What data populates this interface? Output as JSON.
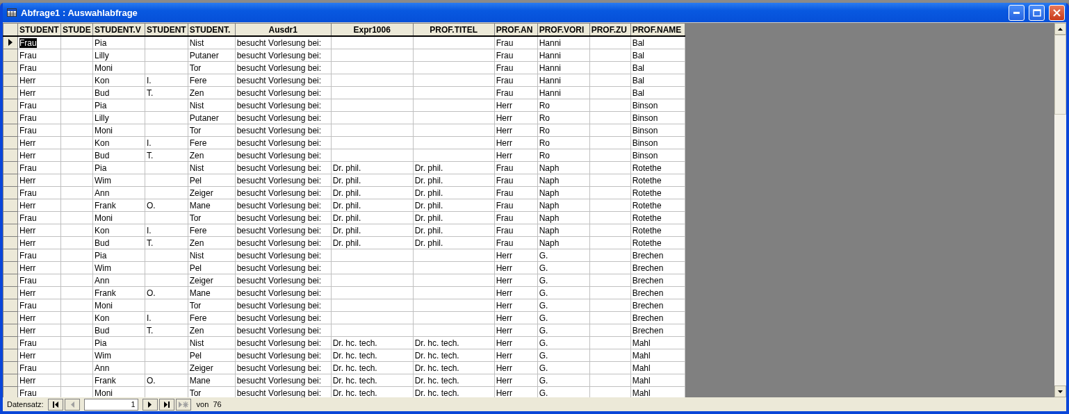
{
  "window": {
    "title": "Abfrage1 : Auswahlabfrage"
  },
  "table": {
    "columns": [
      "STUDENT",
      "STUDE",
      "STUDENT.V",
      "STUDENT",
      "STUDENT.",
      "Ausdr1",
      "Expr1006",
      "PROF.TITEL",
      "PROF.AN",
      "PROF.VORI",
      "PROF.ZU",
      "PROF.NAME"
    ],
    "rows": [
      {
        "selected": true,
        "cells": [
          "Frau",
          "",
          "Pia",
          "",
          "Nist",
          "besucht Vorlesung bei:",
          "",
          "",
          "Frau",
          "Hanni",
          "",
          "Bal"
        ]
      },
      {
        "selected": false,
        "cells": [
          "Frau",
          "",
          "Lilly",
          "",
          "Putaner",
          "besucht Vorlesung bei:",
          "",
          "",
          "Frau",
          "Hanni",
          "",
          "Bal"
        ]
      },
      {
        "selected": false,
        "cells": [
          "Frau",
          "",
          "Moni",
          "",
          "Tor",
          "besucht Vorlesung bei:",
          "",
          "",
          "Frau",
          "Hanni",
          "",
          "Bal"
        ]
      },
      {
        "selected": false,
        "cells": [
          "Herr",
          "",
          "Kon",
          "I.",
          "Fere",
          "besucht Vorlesung bei:",
          "",
          "",
          "Frau",
          "Hanni",
          "",
          "Bal"
        ]
      },
      {
        "selected": false,
        "cells": [
          "Herr",
          "",
          "Bud",
          "T.",
          "Zen",
          "besucht Vorlesung bei:",
          "",
          "",
          "Frau",
          "Hanni",
          "",
          "Bal"
        ]
      },
      {
        "selected": false,
        "cells": [
          "Frau",
          "",
          "Pia",
          "",
          "Nist",
          "besucht Vorlesung bei:",
          "",
          "",
          "Herr",
          "Ro",
          "",
          "Binson"
        ]
      },
      {
        "selected": false,
        "cells": [
          "Frau",
          "",
          "Lilly",
          "",
          "Putaner",
          "besucht Vorlesung bei:",
          "",
          "",
          "Herr",
          "Ro",
          "",
          "Binson"
        ]
      },
      {
        "selected": false,
        "cells": [
          "Frau",
          "",
          "Moni",
          "",
          "Tor",
          "besucht Vorlesung bei:",
          "",
          "",
          "Herr",
          "Ro",
          "",
          "Binson"
        ]
      },
      {
        "selected": false,
        "cells": [
          "Herr",
          "",
          "Kon",
          "I.",
          "Fere",
          "besucht Vorlesung bei:",
          "",
          "",
          "Herr",
          "Ro",
          "",
          "Binson"
        ]
      },
      {
        "selected": false,
        "cells": [
          "Herr",
          "",
          "Bud",
          "T.",
          "Zen",
          "besucht Vorlesung bei:",
          "",
          "",
          "Herr",
          "Ro",
          "",
          "Binson"
        ]
      },
      {
        "selected": false,
        "cells": [
          "Frau",
          "",
          "Pia",
          "",
          "Nist",
          "besucht Vorlesung bei:",
          "Dr. phil.",
          "Dr. phil.",
          "Frau",
          "Naph",
          "",
          "Rotethe"
        ]
      },
      {
        "selected": false,
        "cells": [
          "Herr",
          "",
          "Wim",
          "",
          "Pel",
          "besucht Vorlesung bei:",
          "Dr. phil.",
          "Dr. phil.",
          "Frau",
          "Naph",
          "",
          "Rotethe"
        ]
      },
      {
        "selected": false,
        "cells": [
          "Frau",
          "",
          "Ann",
          "",
          "Zeiger",
          "besucht Vorlesung bei:",
          "Dr. phil.",
          "Dr. phil.",
          "Frau",
          "Naph",
          "",
          "Rotethe"
        ]
      },
      {
        "selected": false,
        "cells": [
          "Herr",
          "",
          "Frank",
          "O.",
          "Mane",
          "besucht Vorlesung bei:",
          "Dr. phil.",
          "Dr. phil.",
          "Frau",
          "Naph",
          "",
          "Rotethe"
        ]
      },
      {
        "selected": false,
        "cells": [
          "Frau",
          "",
          "Moni",
          "",
          "Tor",
          "besucht Vorlesung bei:",
          "Dr. phil.",
          "Dr. phil.",
          "Frau",
          "Naph",
          "",
          "Rotethe"
        ]
      },
      {
        "selected": false,
        "cells": [
          "Herr",
          "",
          "Kon",
          "I.",
          "Fere",
          "besucht Vorlesung bei:",
          "Dr. phil.",
          "Dr. phil.",
          "Frau",
          "Naph",
          "",
          "Rotethe"
        ]
      },
      {
        "selected": false,
        "cells": [
          "Herr",
          "",
          "Bud",
          "T.",
          "Zen",
          "besucht Vorlesung bei:",
          "Dr. phil.",
          "Dr. phil.",
          "Frau",
          "Naph",
          "",
          "Rotethe"
        ]
      },
      {
        "selected": false,
        "cells": [
          "Frau",
          "",
          "Pia",
          "",
          "Nist",
          "besucht Vorlesung bei:",
          "",
          "",
          "Herr",
          "G.",
          "",
          "Brechen"
        ]
      },
      {
        "selected": false,
        "cells": [
          "Herr",
          "",
          "Wim",
          "",
          "Pel",
          "besucht Vorlesung bei:",
          "",
          "",
          "Herr",
          "G.",
          "",
          "Brechen"
        ]
      },
      {
        "selected": false,
        "cells": [
          "Frau",
          "",
          "Ann",
          "",
          "Zeiger",
          "besucht Vorlesung bei:",
          "",
          "",
          "Herr",
          "G.",
          "",
          "Brechen"
        ]
      },
      {
        "selected": false,
        "cells": [
          "Herr",
          "",
          "Frank",
          "O.",
          "Mane",
          "besucht Vorlesung bei:",
          "",
          "",
          "Herr",
          "G.",
          "",
          "Brechen"
        ]
      },
      {
        "selected": false,
        "cells": [
          "Frau",
          "",
          "Moni",
          "",
          "Tor",
          "besucht Vorlesung bei:",
          "",
          "",
          "Herr",
          "G.",
          "",
          "Brechen"
        ]
      },
      {
        "selected": false,
        "cells": [
          "Herr",
          "",
          "Kon",
          "I.",
          "Fere",
          "besucht Vorlesung bei:",
          "",
          "",
          "Herr",
          "G.",
          "",
          "Brechen"
        ]
      },
      {
        "selected": false,
        "cells": [
          "Herr",
          "",
          "Bud",
          "T.",
          "Zen",
          "besucht Vorlesung bei:",
          "",
          "",
          "Herr",
          "G.",
          "",
          "Brechen"
        ]
      },
      {
        "selected": false,
        "cells": [
          "Frau",
          "",
          "Pia",
          "",
          "Nist",
          "besucht Vorlesung bei:",
          "Dr. hc. tech.",
          "Dr. hc. tech.",
          "Herr",
          "G.",
          "",
          "Mahl"
        ]
      },
      {
        "selected": false,
        "cells": [
          "Herr",
          "",
          "Wim",
          "",
          "Pel",
          "besucht Vorlesung bei:",
          "Dr. hc. tech.",
          "Dr. hc. tech.",
          "Herr",
          "G.",
          "",
          "Mahl"
        ]
      },
      {
        "selected": false,
        "cells": [
          "Frau",
          "",
          "Ann",
          "",
          "Zeiger",
          "besucht Vorlesung bei:",
          "Dr. hc. tech.",
          "Dr. hc. tech.",
          "Herr",
          "G.",
          "",
          "Mahl"
        ]
      },
      {
        "selected": false,
        "cells": [
          "Herr",
          "",
          "Frank",
          "O.",
          "Mane",
          "besucht Vorlesung bei:",
          "Dr. hc. tech.",
          "Dr. hc. tech.",
          "Herr",
          "G.",
          "",
          "Mahl"
        ]
      },
      {
        "selected": false,
        "cells": [
          "Frau",
          "",
          "Moni",
          "",
          "Tor",
          "besucht Vorlesung bei:",
          "Dr. hc. tech.",
          "Dr. hc. tech.",
          "Herr",
          "G.",
          "",
          "Mahl"
        ]
      }
    ]
  },
  "navigator": {
    "label": "Datensatz:",
    "record": "1",
    "total": "von  76",
    "buttons": [
      {
        "kind": "first",
        "disabled": false
      },
      {
        "kind": "prev",
        "disabled": true
      },
      {
        "kind": "field"
      },
      {
        "kind": "next",
        "disabled": false
      },
      {
        "kind": "last",
        "disabled": false
      },
      {
        "kind": "new",
        "disabled": true
      }
    ]
  }
}
